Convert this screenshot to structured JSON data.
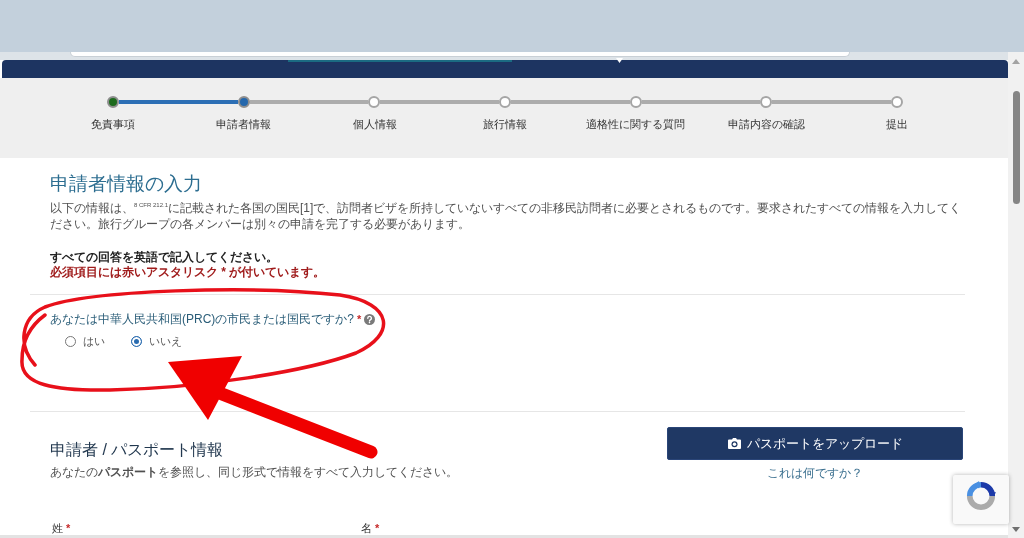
{
  "progress_steps": [
    {
      "label": "免責事項",
      "completed": true,
      "selected": false
    },
    {
      "label": "申請者情報",
      "completed": false,
      "selected": true
    },
    {
      "label": "個人情報",
      "completed": false,
      "selected": false
    },
    {
      "label": "旅行情報",
      "completed": false,
      "selected": false
    },
    {
      "label": "適格性に関する質問",
      "completed": false,
      "selected": false
    },
    {
      "label": "申請内容の確認",
      "completed": false,
      "selected": false
    },
    {
      "label": "提出",
      "completed": false,
      "selected": false
    }
  ],
  "intro": {
    "title": "申請者情報の入力",
    "description": "以下の情報は、$^{8 CFR 212.1}$に記載された各国の国民[1]で、訪問者ビザを所持していないすべての非移民訪問者に必要とされるものです。要求されたすべての情報を入力してください。旅行グループの各メンバーは別々の申請を完了する必要があります。",
    "notice": "すべての回答を英語で記入してください。",
    "required_note": "必須項目には赤いアスタリスク * が付いています。"
  },
  "citizenship_question": {
    "label": "あなたは中華人民共和国(PRC)の市民または国民ですか?",
    "required_mark": "*",
    "options": [
      {
        "label": "はい",
        "selected": false
      },
      {
        "label": "いいえ",
        "selected": true
      }
    ]
  },
  "passport_section": {
    "title": "申請者 / パスポート情報",
    "description": "あなたの**パスポート**を参照し、同じ形式で情報をすべて入力してください。",
    "upload_button": "パスポートをアップロード",
    "help_link": "これは何ですか？",
    "fields": [
      {
        "label": "姓",
        "required_mark": "*"
      },
      {
        "label": "名",
        "required_mark": "*"
      }
    ]
  },
  "annotations": [
    {
      "kind": "loop"
    },
    {
      "kind": "arrow"
    }
  ]
}
